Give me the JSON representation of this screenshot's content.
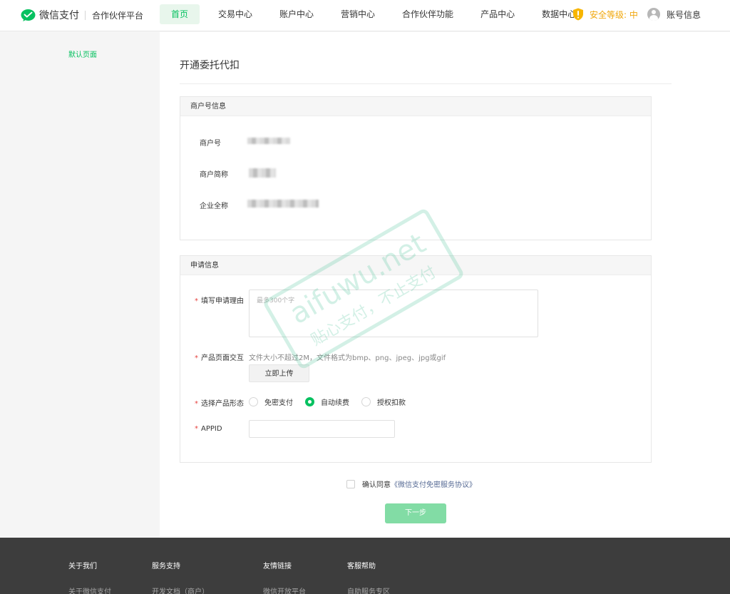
{
  "header": {
    "logo_text": "微信支付",
    "platform": "合作伙伴平台",
    "nav": [
      "首页",
      "交易中心",
      "账户中心",
      "营销中心",
      "合作伙伴功能",
      "产品中心",
      "数据中心"
    ],
    "security_label": "安全等级: 中",
    "account_label": "账号信息",
    "colors": {
      "brand": "#07c160",
      "security": "#f0a70d"
    }
  },
  "sidebar": {
    "items": [
      {
        "label": "默认页面"
      }
    ]
  },
  "main": {
    "title": "开通委托代扣",
    "merchant_panel": {
      "title": "商户号信息",
      "fields": [
        {
          "label": "商户号"
        },
        {
          "label": "商户简称"
        },
        {
          "label": "企业全称"
        }
      ]
    },
    "apply_panel": {
      "title": "申请信息",
      "reason_label": "填写申请理由",
      "reason_placeholder": "最多300个字",
      "page_label": "产品页面交互",
      "upload_hint": "文件大小不超过2M，文件格式为bmp、png、jpeg、jpg或gif",
      "upload_button": "立即上传",
      "form_label": "选择产品形态",
      "form_options": [
        {
          "label": "免密支付",
          "checked": false
        },
        {
          "label": "自动续费",
          "checked": true
        },
        {
          "label": "授权扣款",
          "checked": false
        }
      ],
      "appid_label": "APPID",
      "required_mark": "*"
    },
    "agree_text": "确认同意",
    "agree_link": "《微信支付免密服务协议》",
    "next_button": "下一步"
  },
  "watermark": {
    "line1": "aifuwu.net",
    "line2": "贴心支付，不止支付"
  },
  "footer": {
    "columns": [
      {
        "title": "关于我们",
        "link": "关于微信支付"
      },
      {
        "title": "服务支持",
        "link": "开发文档（商户）"
      },
      {
        "title": "友情链接",
        "link": "微信开放平台"
      },
      {
        "title": "客服帮助",
        "link": "自助服务专区"
      }
    ]
  }
}
